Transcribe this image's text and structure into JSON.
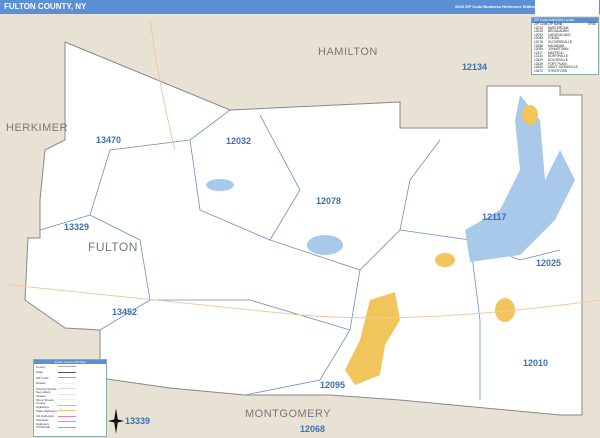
{
  "header": {
    "title": "FULTON COUNTY, NY",
    "edition": "2020 ZIP Code Business Reference Edition"
  },
  "counties": {
    "main": "FULTON",
    "north": "HAMILTON",
    "west": "HERKIMER",
    "south": "MONTGOMERY"
  },
  "zips": [
    "13470",
    "12032",
    "12134",
    "12078",
    "13329",
    "12117",
    "12025",
    "13452",
    "12010",
    "12095",
    "13339",
    "12068"
  ],
  "index": {
    "title": "ZIP Code Index/Grid Locator",
    "headers": [
      "ZIP Code",
      "ZIP Name",
      "GRID"
    ],
    "rows": [
      [
        "12010",
        "AMSTERDAM"
      ],
      [
        "12025",
        "BROADALBIN"
      ],
      [
        "12032",
        "CAROGA LAKE"
      ],
      [
        "12068",
        "FONDA"
      ],
      [
        "12078",
        "GLOVERSVILLE"
      ],
      [
        "12086",
        "HAGAMAN"
      ],
      [
        "12095",
        "JOHNSTOWN"
      ],
      [
        "12117",
        "MAYFIELD"
      ],
      [
        "12134",
        "NORTHVILLE"
      ],
      [
        "13329",
        "DOLGEVILLE"
      ],
      [
        "13339",
        "FORT PLAIN"
      ],
      [
        "13452",
        "SAINT JOHNSVILLE"
      ],
      [
        "13470",
        "STRATFORD"
      ]
    ]
  },
  "legend": {
    "title": "Fulton County ZIP Map",
    "items": [
      "County",
      "State",
      "ZIP Code",
      "Streets",
      "Primary Streets",
      "Secondary Streets",
      "Minor Streets",
      "County Highways",
      "State Highways",
      "US Highways",
      "Interstate Highways",
      "Toll Roads"
    ],
    "colors": [
      "#aaaaaa",
      "#555555",
      "#7aa7dc",
      "#eeeeee",
      "#dddddd",
      "#e6e6e6",
      "#f0f0f0",
      "#bbbbbb",
      "#f5c27a",
      "#f07acb",
      "#7ab8f0",
      "#66cc66"
    ]
  },
  "colors": {
    "header": "#5b8fd6",
    "water": "#a9c9ea",
    "urban": "#f2c45c",
    "land": "#ffffff",
    "outside": "#e8e2d4"
  }
}
